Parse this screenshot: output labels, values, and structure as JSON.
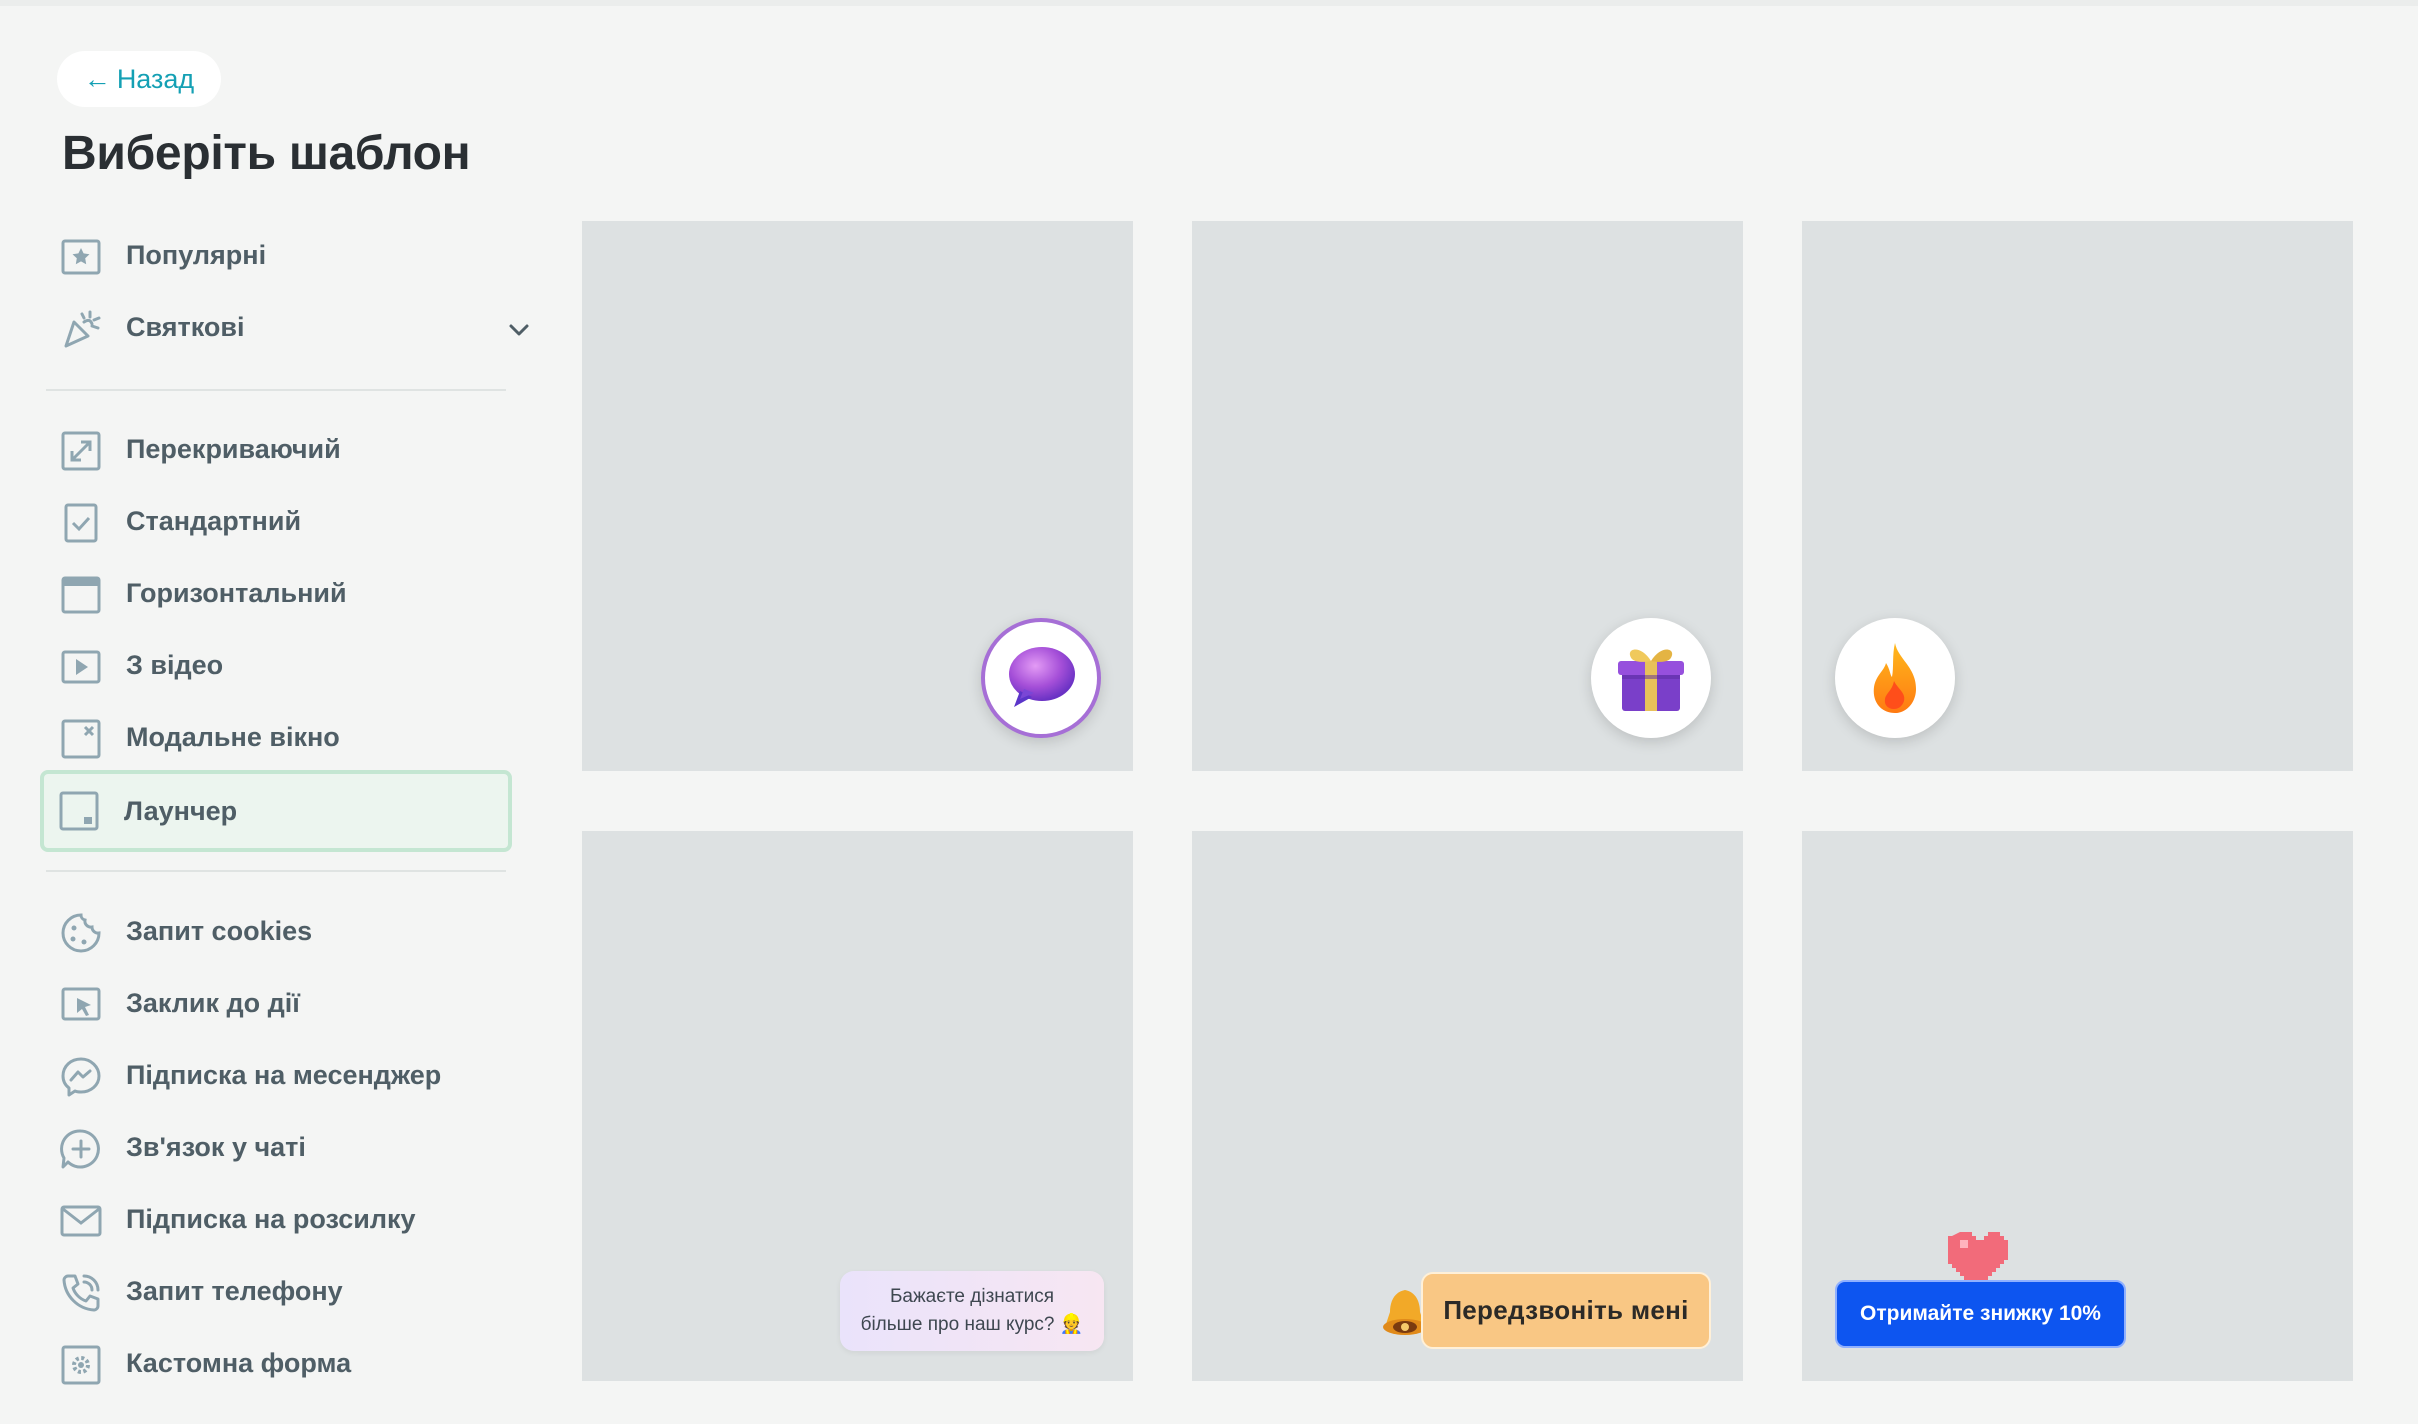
{
  "header": {
    "back_arrow": "←",
    "back_label": "Назад",
    "title": "Виберіть шаблон"
  },
  "sidebar": {
    "group1": [
      {
        "label": "Популярні",
        "icon": "star-icon"
      },
      {
        "label": "Святкові",
        "icon": "party-popper-icon",
        "expandable": true
      }
    ],
    "group2": [
      {
        "label": "Перекриваючий",
        "icon": "expand-icon"
      },
      {
        "label": "Стандартний",
        "icon": "checkbox-icon"
      },
      {
        "label": "Горизонтальний",
        "icon": "horizontal-bar-icon"
      },
      {
        "label": "З відео",
        "icon": "video-play-icon"
      },
      {
        "label": "Модальне вікно",
        "icon": "modal-close-icon"
      },
      {
        "label": "Лаунчер",
        "icon": "launcher-icon",
        "active": true
      }
    ],
    "group3": [
      {
        "label": "Запит cookies",
        "icon": "cookie-icon"
      },
      {
        "label": "Заклик до дії",
        "icon": "cursor-click-icon"
      },
      {
        "label": "Підписка на месенджер",
        "icon": "messenger-icon"
      },
      {
        "label": "Зв'язок у чаті",
        "icon": "chat-plus-icon"
      },
      {
        "label": "Підписка на розсилку",
        "icon": "envelope-icon"
      },
      {
        "label": "Запит телефону",
        "icon": "phone-icon"
      },
      {
        "label": "Кастомна форма",
        "icon": "gear-icon"
      }
    ]
  },
  "templates": [
    {
      "launcher": "chat-bubble-icon"
    },
    {
      "launcher": "gift-icon"
    },
    {
      "launcher": "fire-icon"
    },
    {
      "bubble_line1": "Бажаєте дізнатися",
      "bubble_line2": "більше про наш курс? 👷"
    },
    {
      "button_label": "Передзвоніть мені",
      "icon": "bell-icon"
    },
    {
      "button_label": "Отримайте знижку 10%",
      "icon": "pixel-heart-icon"
    }
  ],
  "colors": {
    "accent": "#14a0b4",
    "active_bg": "#ecf5ef",
    "active_border": "#c4e6d2",
    "card_bg": "#dde1e2",
    "discount_blue": "#0d55f0",
    "callme_orange": "#f9c784"
  }
}
